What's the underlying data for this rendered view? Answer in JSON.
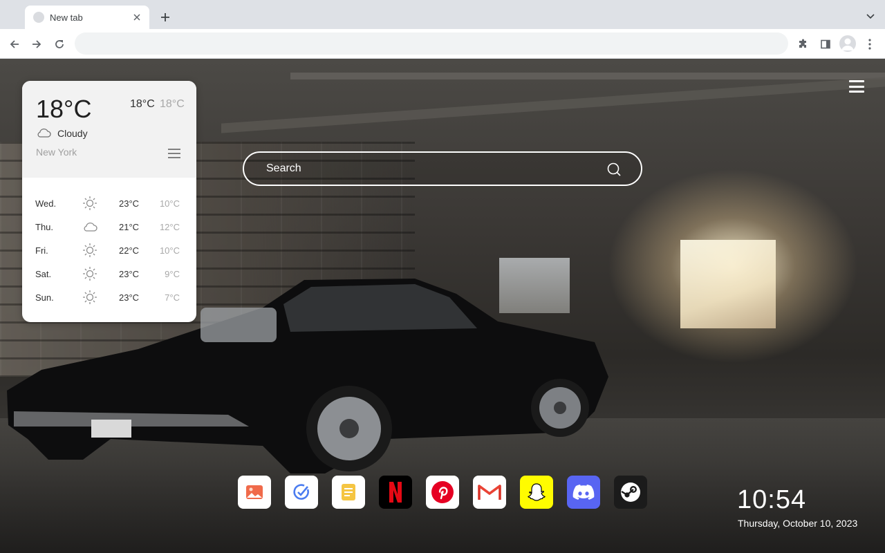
{
  "browser": {
    "tab_title": "New tab",
    "omnibox_value": "",
    "icons": {
      "tab_favicon": "default-favicon-icon",
      "tab_close": "close-icon",
      "new_tab": "plus-icon",
      "tab_search": "chevron-down-icon",
      "back": "arrow-left-icon",
      "forward": "arrow-right-icon",
      "reload": "reload-icon",
      "extensions": "puzzle-icon",
      "side_panel": "side-panel-icon",
      "profile": "avatar-icon",
      "menu": "kebab-menu-icon"
    }
  },
  "weather": {
    "current_temp": "18°C",
    "high": "18°C",
    "low": "18°C",
    "condition": "Cloudy",
    "condition_icon": "cloud-icon",
    "city": "New York",
    "forecast": [
      {
        "day": "Wed.",
        "icon": "sun-icon",
        "high": "23°C",
        "low": "10°C"
      },
      {
        "day": "Thu.",
        "icon": "cloud-icon",
        "high": "21°C",
        "low": "12°C"
      },
      {
        "day": "Fri.",
        "icon": "sun-icon",
        "high": "22°C",
        "low": "10°C"
      },
      {
        "day": "Sat.",
        "icon": "sun-icon",
        "high": "23°C",
        "low": "9°C"
      },
      {
        "day": "Sun.",
        "icon": "sun-icon",
        "high": "23°C",
        "low": "7°C"
      }
    ]
  },
  "search": {
    "placeholder": "Search"
  },
  "dock": {
    "apps": [
      {
        "name": "gallery",
        "icon": "image-icon",
        "bg": "#ffffff"
      },
      {
        "name": "tasks",
        "icon": "check-circle-icon",
        "bg": "#ffffff"
      },
      {
        "name": "notes",
        "icon": "note-icon",
        "bg": "#ffffff"
      },
      {
        "name": "netflix",
        "icon": "netflix-icon",
        "bg": "#000000"
      },
      {
        "name": "pinterest",
        "icon": "pinterest-icon",
        "bg": "#ffffff"
      },
      {
        "name": "gmail",
        "icon": "gmail-icon",
        "bg": "#ffffff"
      },
      {
        "name": "snapchat",
        "icon": "snapchat-icon",
        "bg": "#fffc00"
      },
      {
        "name": "discord",
        "icon": "discord-icon",
        "bg": "#5865f2"
      },
      {
        "name": "steam",
        "icon": "steam-icon",
        "bg": "#1b1b1b"
      }
    ]
  },
  "clock": {
    "time": "10:54",
    "date": "Thursday, October 10, 2023"
  },
  "colors": {
    "tabstrip": "#dee1e6",
    "toolbar": "#ffffff",
    "omnibox": "#f1f3f4",
    "widget_bg": "#ffffff",
    "widget_head": "#f2f2f2"
  }
}
